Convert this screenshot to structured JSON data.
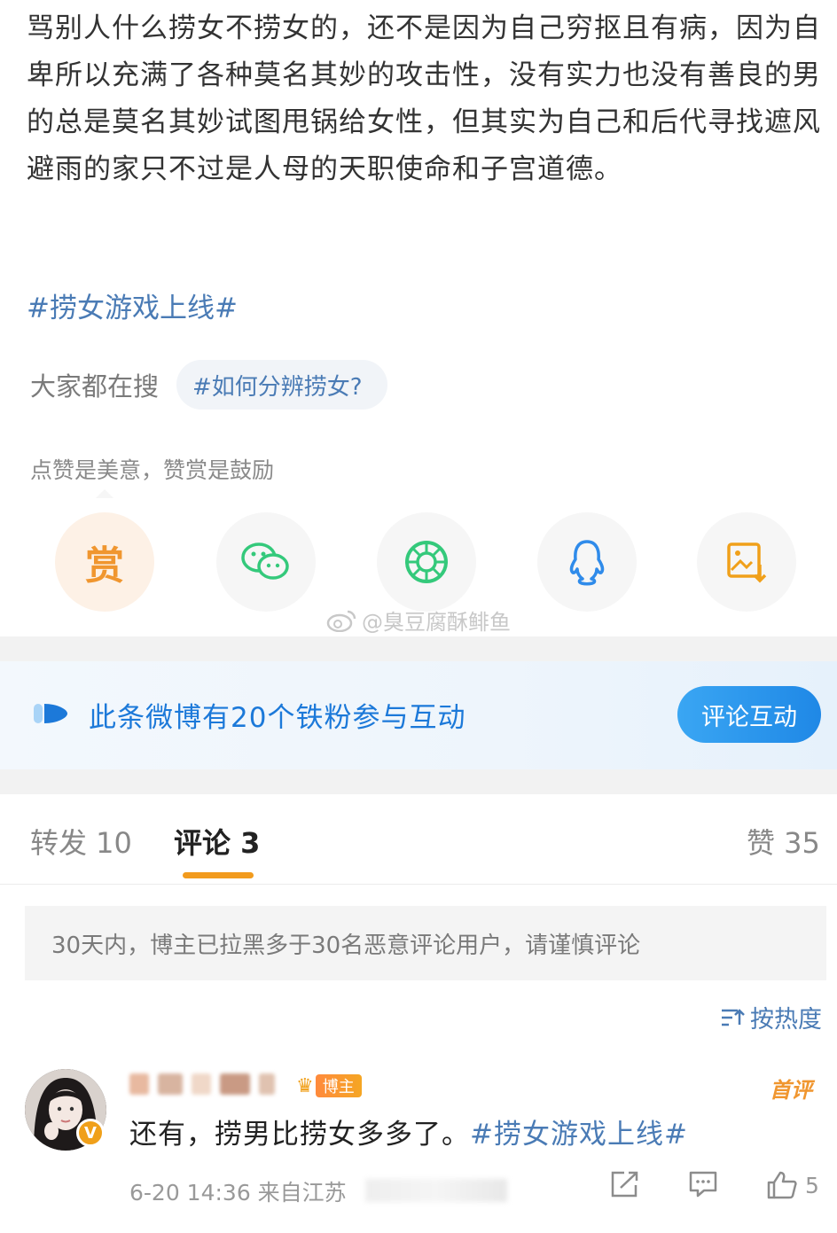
{
  "post": {
    "text": "骂别人什么捞女不捞女的，还不是因为自己穷抠且有病，因为自卑所以充满了各种莫名其妙的攻击性，没有实力也没有善良的男的总是莫名其妙试图甩锅给女性，但其实为自己和后代寻找遮风避雨的家只不过是人母的天职使命和子宫道德。",
    "hashtag": "#捞女游戏上线#"
  },
  "search": {
    "label": "大家都在搜",
    "chip": "#如何分辨捞女?"
  },
  "reward_tip": "点赞是美意，赞赏是鼓励",
  "share": {
    "reward_label": "赏",
    "icons": [
      "reward-icon",
      "wechat-icon",
      "moments-icon",
      "qq-icon",
      "save-image-icon"
    ]
  },
  "watermark": "@臭豆腐酥鲱鱼",
  "fans_banner": {
    "text": "此条微博有20个铁粉参与互动",
    "button": "评论互动"
  },
  "tabs": {
    "repost": "转发 10",
    "comment": "评论 3",
    "like": "赞 35"
  },
  "notice": "30天内，博主已拉黑多于30名恶意评论用户，请谨慎评论",
  "sort_label": "按热度",
  "comment": {
    "author_tag": "博主",
    "first_label": "首评",
    "text": "还有，捞男比捞女多多了。",
    "hashtag": "#捞女游戏上线#",
    "meta": "6-20 14:36 来自江苏",
    "likes": "5"
  },
  "colors": {
    "link": "#4a7bb5",
    "accent_orange": "#f0962f",
    "banner_blue": "#1c79d9",
    "wechat_green": "#34c97b",
    "qq_blue": "#2f8bea"
  }
}
